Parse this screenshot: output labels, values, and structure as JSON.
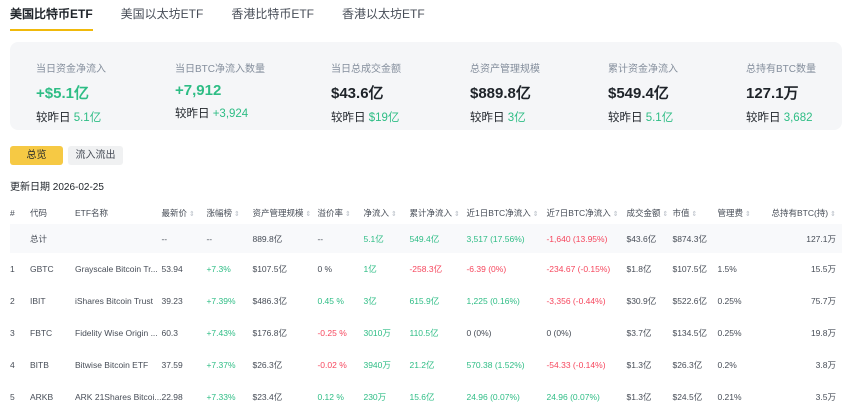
{
  "tabs": [
    "美国比特币ETF",
    "美国以太坊ETF",
    "香港比特币ETF",
    "香港以太坊ETF"
  ],
  "stats": [
    {
      "label": "当日资金净流入",
      "value": "+$5.1亿",
      "cmp_label": "较昨日",
      "cmp": "5.1亿",
      "green": true
    },
    {
      "label": "当日BTC净流入数量",
      "value": "+7,912",
      "cmp_label": "较昨日",
      "cmp": "+3,924",
      "green": true
    },
    {
      "label": "当日总成交金额",
      "value": "$43.6亿",
      "cmp_label": "较昨日",
      "cmp": "$19亿"
    },
    {
      "label": "总资产管理规模",
      "value": "$889.8亿",
      "cmp_label": "较昨日",
      "cmp": "3亿"
    },
    {
      "label": "累计资金净流入",
      "value": "$549.4亿",
      "cmp_label": "较昨日",
      "cmp": "5.1亿"
    },
    {
      "label": "总持有BTC数量",
      "value": "127.1万",
      "cmp_label": "较昨日",
      "cmp": "3,682"
    }
  ],
  "buttons": {
    "overview": "总览",
    "flows": "流入流出"
  },
  "update_date": "更新日期 2026-02-25",
  "table": {
    "headers": [
      "#",
      "代码",
      "ETF名称",
      "最新价",
      "涨幅榜",
      "资产管理规模",
      "溢价率",
      "净流入",
      "累计净流入",
      "近1日BTC净流入",
      "近7日BTC净流入",
      "成交金额",
      "市值",
      "管理费",
      "总持有BTC(持)"
    ],
    "total": [
      "",
      "总计",
      "",
      "--",
      "--",
      "889.8亿",
      "--",
      "5.1亿",
      "549.4亿",
      "3,517 (17.56%)",
      "-1,640 (13.95%)",
      "$43.6亿",
      "$874.3亿",
      "",
      "127.1万"
    ],
    "rows": [
      [
        "1",
        "GBTC",
        "Grayscale Bitcoin Tr...",
        "53.94",
        "+7.3%",
        "$107.5亿",
        "0 %",
        "1亿",
        "-258.3亿",
        "-6.39 (0%)",
        "-234.67 (-0.15%)",
        "$1.8亿",
        "$107.5亿",
        "1.5%",
        "15.5万"
      ],
      [
        "2",
        "IBIT",
        "iShares Bitcoin Trust",
        "39.23",
        "+7.39%",
        "$486.3亿",
        "0.45 %",
        "3亿",
        "615.9亿",
        "1,225 (0.16%)",
        "-3,356 (-0.44%)",
        "$30.9亿",
        "$522.6亿",
        "0.25%",
        "75.7万"
      ],
      [
        "3",
        "FBTC",
        "Fidelity Wise Origin ...",
        "60.3",
        "+7.43%",
        "$176.8亿",
        "-0.25 %",
        "3010万",
        "110.5亿",
        "0 (0%)",
        "0 (0%)",
        "$3.7亿",
        "$134.5亿",
        "0.25%",
        "19.8万"
      ],
      [
        "4",
        "BITB",
        "Bitwise Bitcoin ETF",
        "37.59",
        "+7.37%",
        "$26.3亿",
        "-0.02 %",
        "3940万",
        "21.2亿",
        "570.38 (1.52%)",
        "-54.33 (-0.14%)",
        "$1.3亿",
        "$26.3亿",
        "0.2%",
        "3.8万"
      ],
      [
        "5",
        "ARKB",
        "ARK 21Shares Bitcoi...",
        "22.98",
        "+7.33%",
        "$23.4亿",
        "0.12 %",
        "230万",
        "15.6亿",
        "24.96 (0.07%)",
        "24.96 (0.07%)",
        "$1.3亿",
        "$24.5亿",
        "0.21%",
        "3.5万"
      ]
    ]
  },
  "colors": {
    "green": "#2ebd85",
    "red": "#f6465d",
    "accent": "#f0b90b"
  }
}
